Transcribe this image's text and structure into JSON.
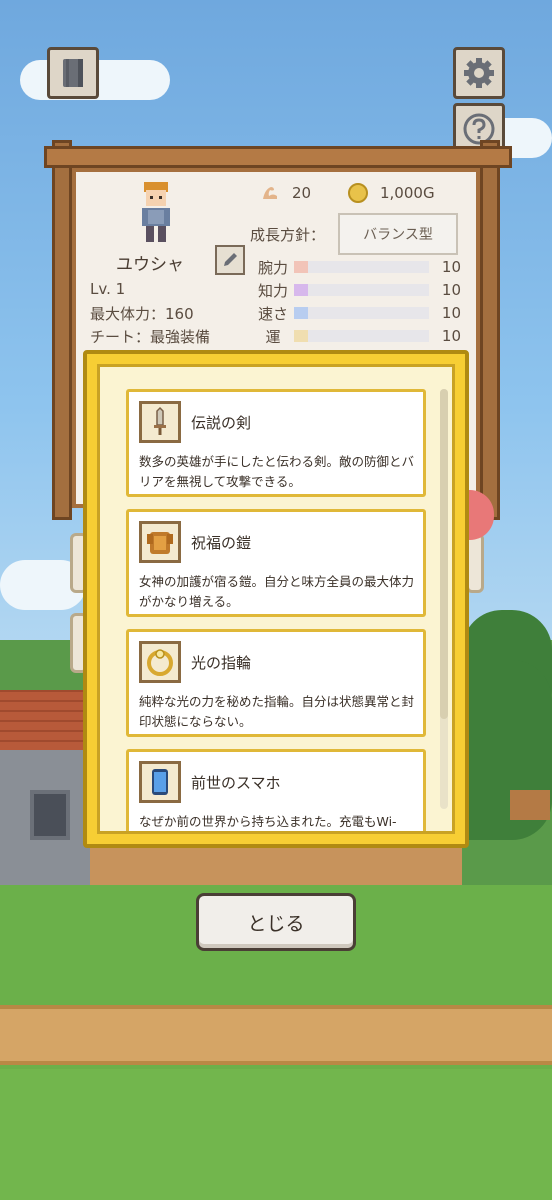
{
  "hero": {
    "name": "ユウシャ",
    "level": "Lv. 1",
    "max_hp": "最大体力：160",
    "cheat": "チート：最強装備"
  },
  "resources": {
    "strength_points": "20",
    "gold": "1,000G"
  },
  "growth": {
    "label": "成長方針：",
    "value": "バランス型"
  },
  "stats": [
    {
      "name": "腕力",
      "value": "10",
      "fill": 0.1,
      "color": "#f2c4b8"
    },
    {
      "name": "知力",
      "value": "10",
      "fill": 0.1,
      "color": "#d7b8ec"
    },
    {
      "name": "速さ",
      "value": "10",
      "fill": 0.1,
      "color": "#b8cdf0"
    },
    {
      "name": "運",
      "value": "10",
      "fill": 0.1,
      "color": "#f0deb0"
    }
  ],
  "equipment": [
    {
      "icon": "sword-icon",
      "title": "伝説の剣",
      "desc": "数多の英雄が手にしたと伝わる剣。敵の防御とバリアを無視して攻撃できる。"
    },
    {
      "icon": "armor-icon",
      "title": "祝福の鎧",
      "desc": "女神の加護が宿る鎧。自分と味方全員の最大体力がかなり増える。"
    },
    {
      "icon": "ring-icon",
      "title": "光の指輪",
      "desc": "純粋な光の力を秘めた指輪。自分は状態異常と封印状態にならない。"
    },
    {
      "icon": "smartphone-icon",
      "title": "前世のスマホ",
      "desc": "なぜか前の世界から持ち込まれた。充電もWi-"
    }
  ],
  "close_label": "とじる"
}
